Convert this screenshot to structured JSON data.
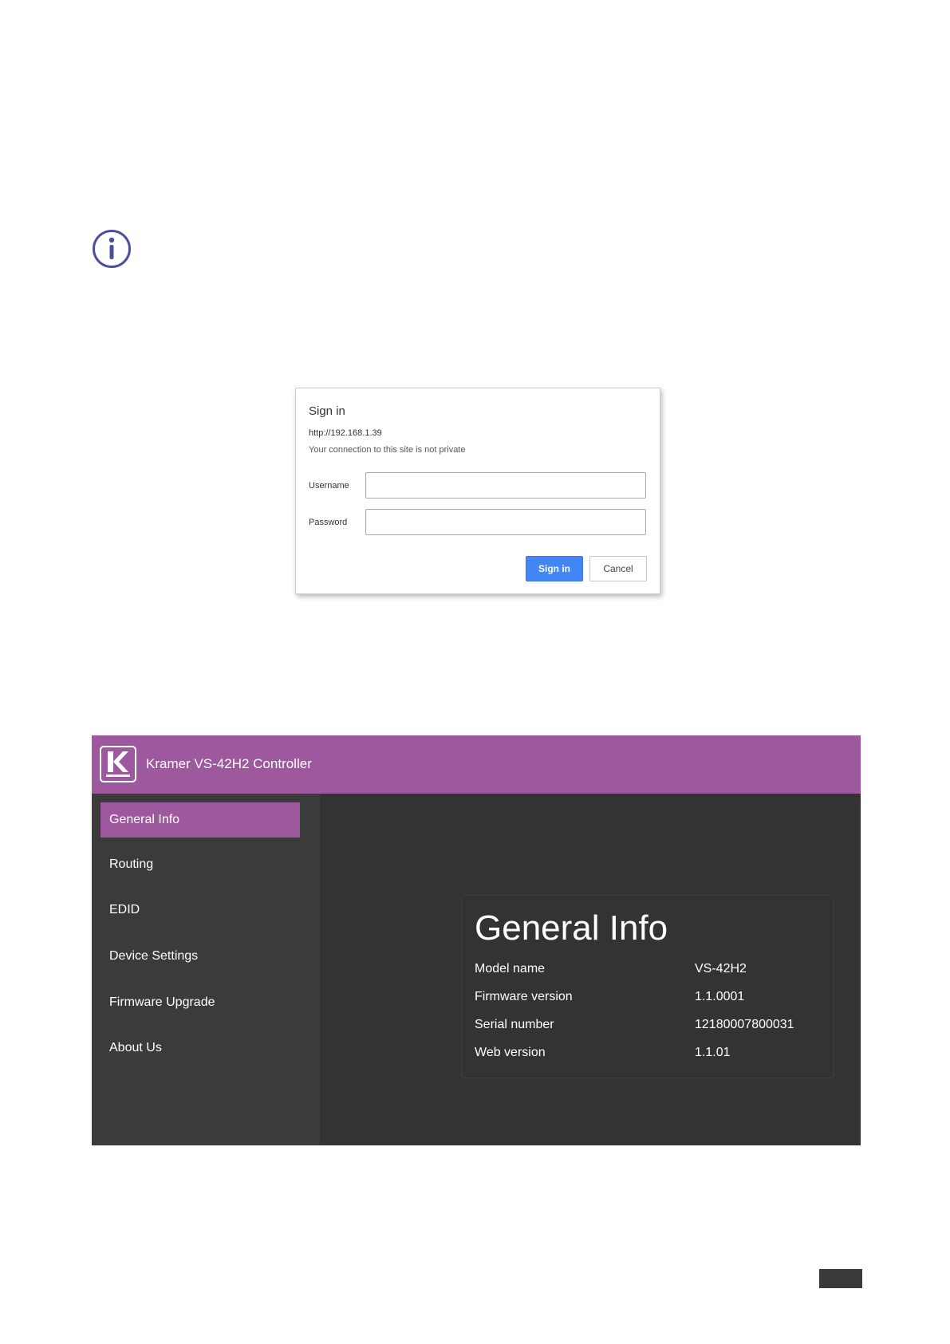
{
  "signin": {
    "title": "Sign in",
    "url": "http://192.168.1.39",
    "warning": "Your connection to this site is not private",
    "username_label": "Username",
    "username_value": "",
    "password_label": "Password",
    "password_value": "",
    "sign_in_button": "Sign in",
    "cancel_button": "Cancel"
  },
  "controller": {
    "header_title": "Kramer VS-42H2 Controller",
    "nav": [
      {
        "label": "General Info",
        "active": true
      },
      {
        "label": "Routing",
        "active": false
      },
      {
        "label": "EDID",
        "active": false
      },
      {
        "label": "Device Settings",
        "active": false
      },
      {
        "label": "Firmware Upgrade",
        "active": false
      },
      {
        "label": "About Us",
        "active": false
      }
    ],
    "panel_title": "General Info",
    "info": [
      {
        "key": "Model name",
        "value": "VS-42H2"
      },
      {
        "key": "Firmware version",
        "value": "1.1.0001"
      },
      {
        "key": "Serial number",
        "value": "12180007800031"
      },
      {
        "key": "Web version",
        "value": "1.1.01"
      }
    ]
  },
  "colors": {
    "accent": "#9e589d",
    "sidebar": "#3b3b3b",
    "main": "#333333",
    "sign_in_blue": "#4285f4",
    "info_icon": "#4a4f9c"
  },
  "icons": [
    "info-icon",
    "kramer-logo"
  ]
}
